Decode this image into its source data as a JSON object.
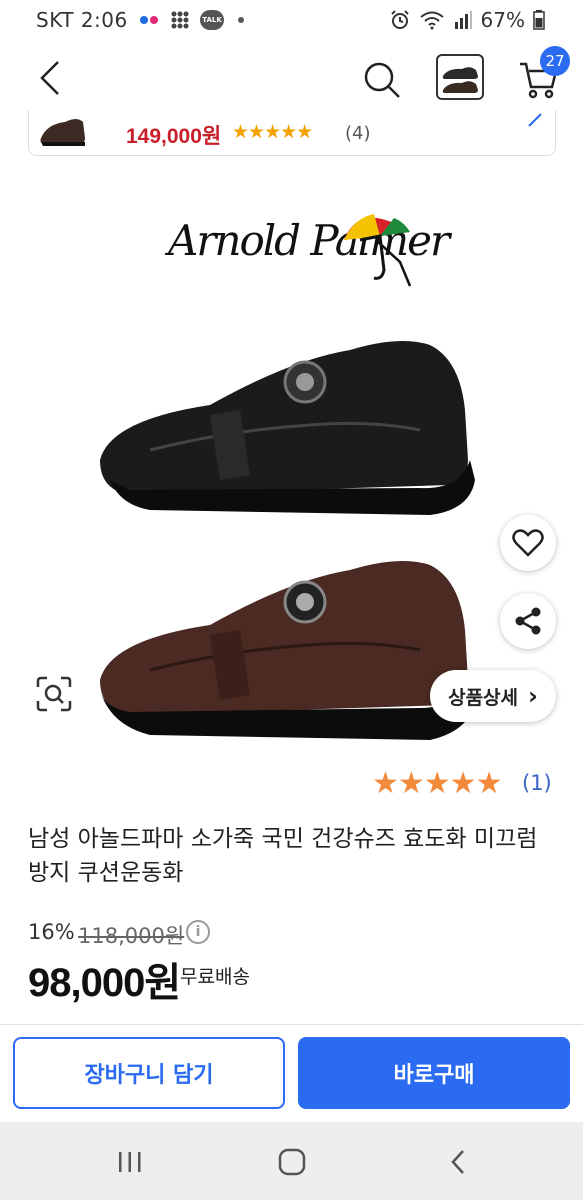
{
  "status_bar": {
    "time": "SKT 2:06",
    "talk_badge": "TALK",
    "battery": "67%"
  },
  "header": {
    "cart_count": "27"
  },
  "mini_card": {
    "price": "149,000원",
    "stars": "★★★★★",
    "review_count": "(4)"
  },
  "brand": {
    "logo_text": "Arnold Palmer"
  },
  "floating": {
    "detail_label": "상품상세",
    "detail_chevron": "›"
  },
  "rating": {
    "stars": "★★★★★",
    "count": "(1)"
  },
  "product": {
    "title": "남성 아놀드파마 소가죽 국민 건강슈즈 효도화 미끄럼방지 쿠션운동화",
    "discount": "16%",
    "original_price": "118,000원",
    "info": "i",
    "price": "98,000원",
    "shipping": "무료배송"
  },
  "actions": {
    "cart_label": "장바구니 담기",
    "buy_label": "바로구매"
  },
  "colors": {
    "accent": "#2a6bf2",
    "mini_price": "#c8202a",
    "star": "#f28a3b",
    "review_link": "#3b63c7"
  }
}
